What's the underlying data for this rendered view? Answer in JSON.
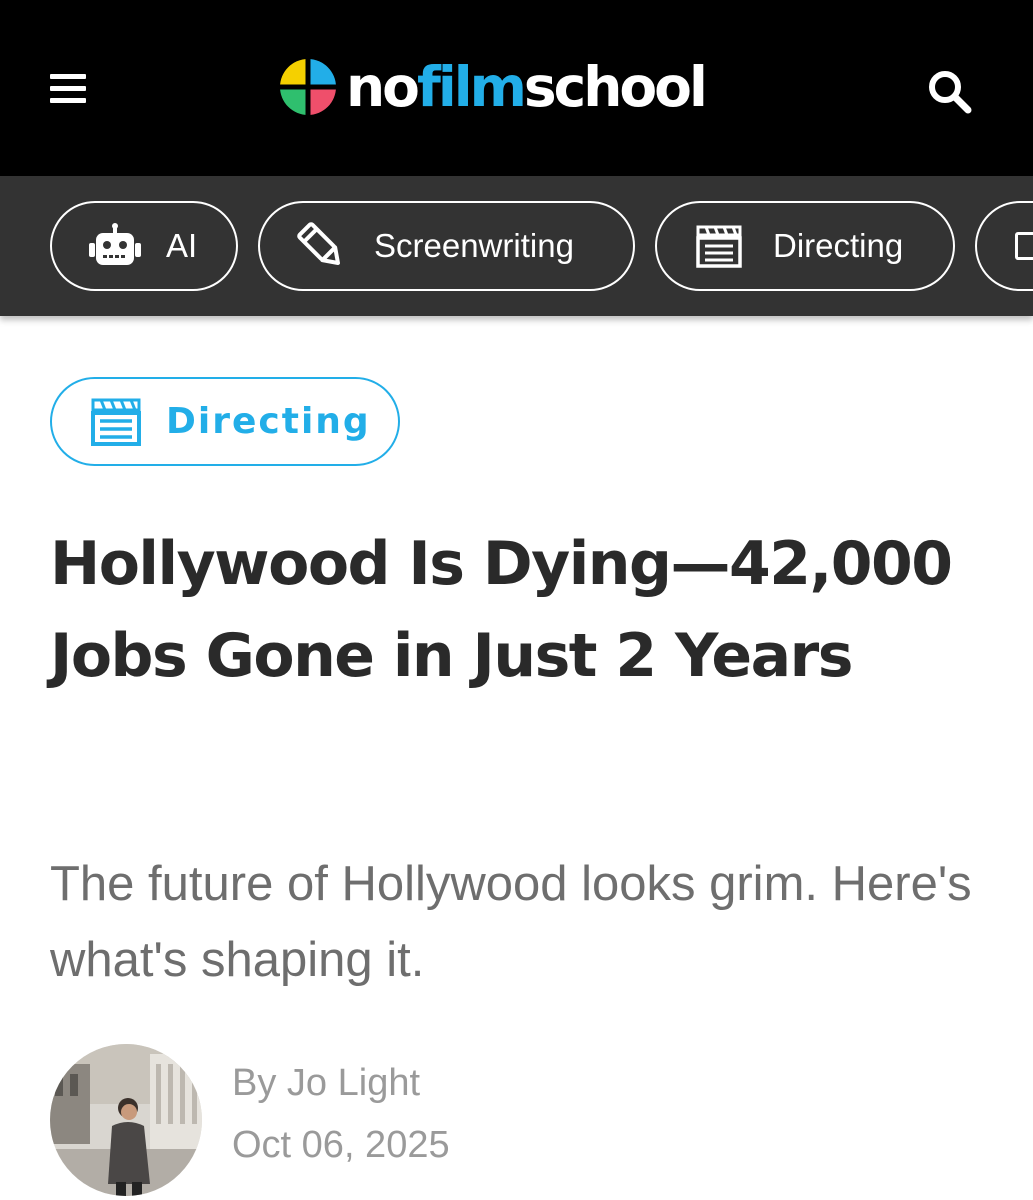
{
  "header": {
    "logo": {
      "part1": "no",
      "part2": "film",
      "part3": "school"
    },
    "menu_icon": "hamburger-menu-icon",
    "search_icon": "search-icon",
    "colors": {
      "background": "#000000",
      "brand_blue": "#22aee8"
    }
  },
  "categories": [
    {
      "label": "AI",
      "icon": "robot-icon"
    },
    {
      "label": "Screenwriting",
      "icon": "pencil-icon"
    },
    {
      "label": "Directing",
      "icon": "clapperboard-icon"
    }
  ],
  "article": {
    "category_tag": {
      "label": "Directing",
      "icon": "clapperboard-icon",
      "color": "#22aee8"
    },
    "title": "Hollywood Is Dying—42,000 Jobs Gone in Just 2 Years",
    "subtitle": "The future of Hollywood looks grim. Here's what's shaping it.",
    "author": {
      "prefix": "By",
      "name": "Jo Light"
    },
    "date": "Oct 06, 2025"
  }
}
